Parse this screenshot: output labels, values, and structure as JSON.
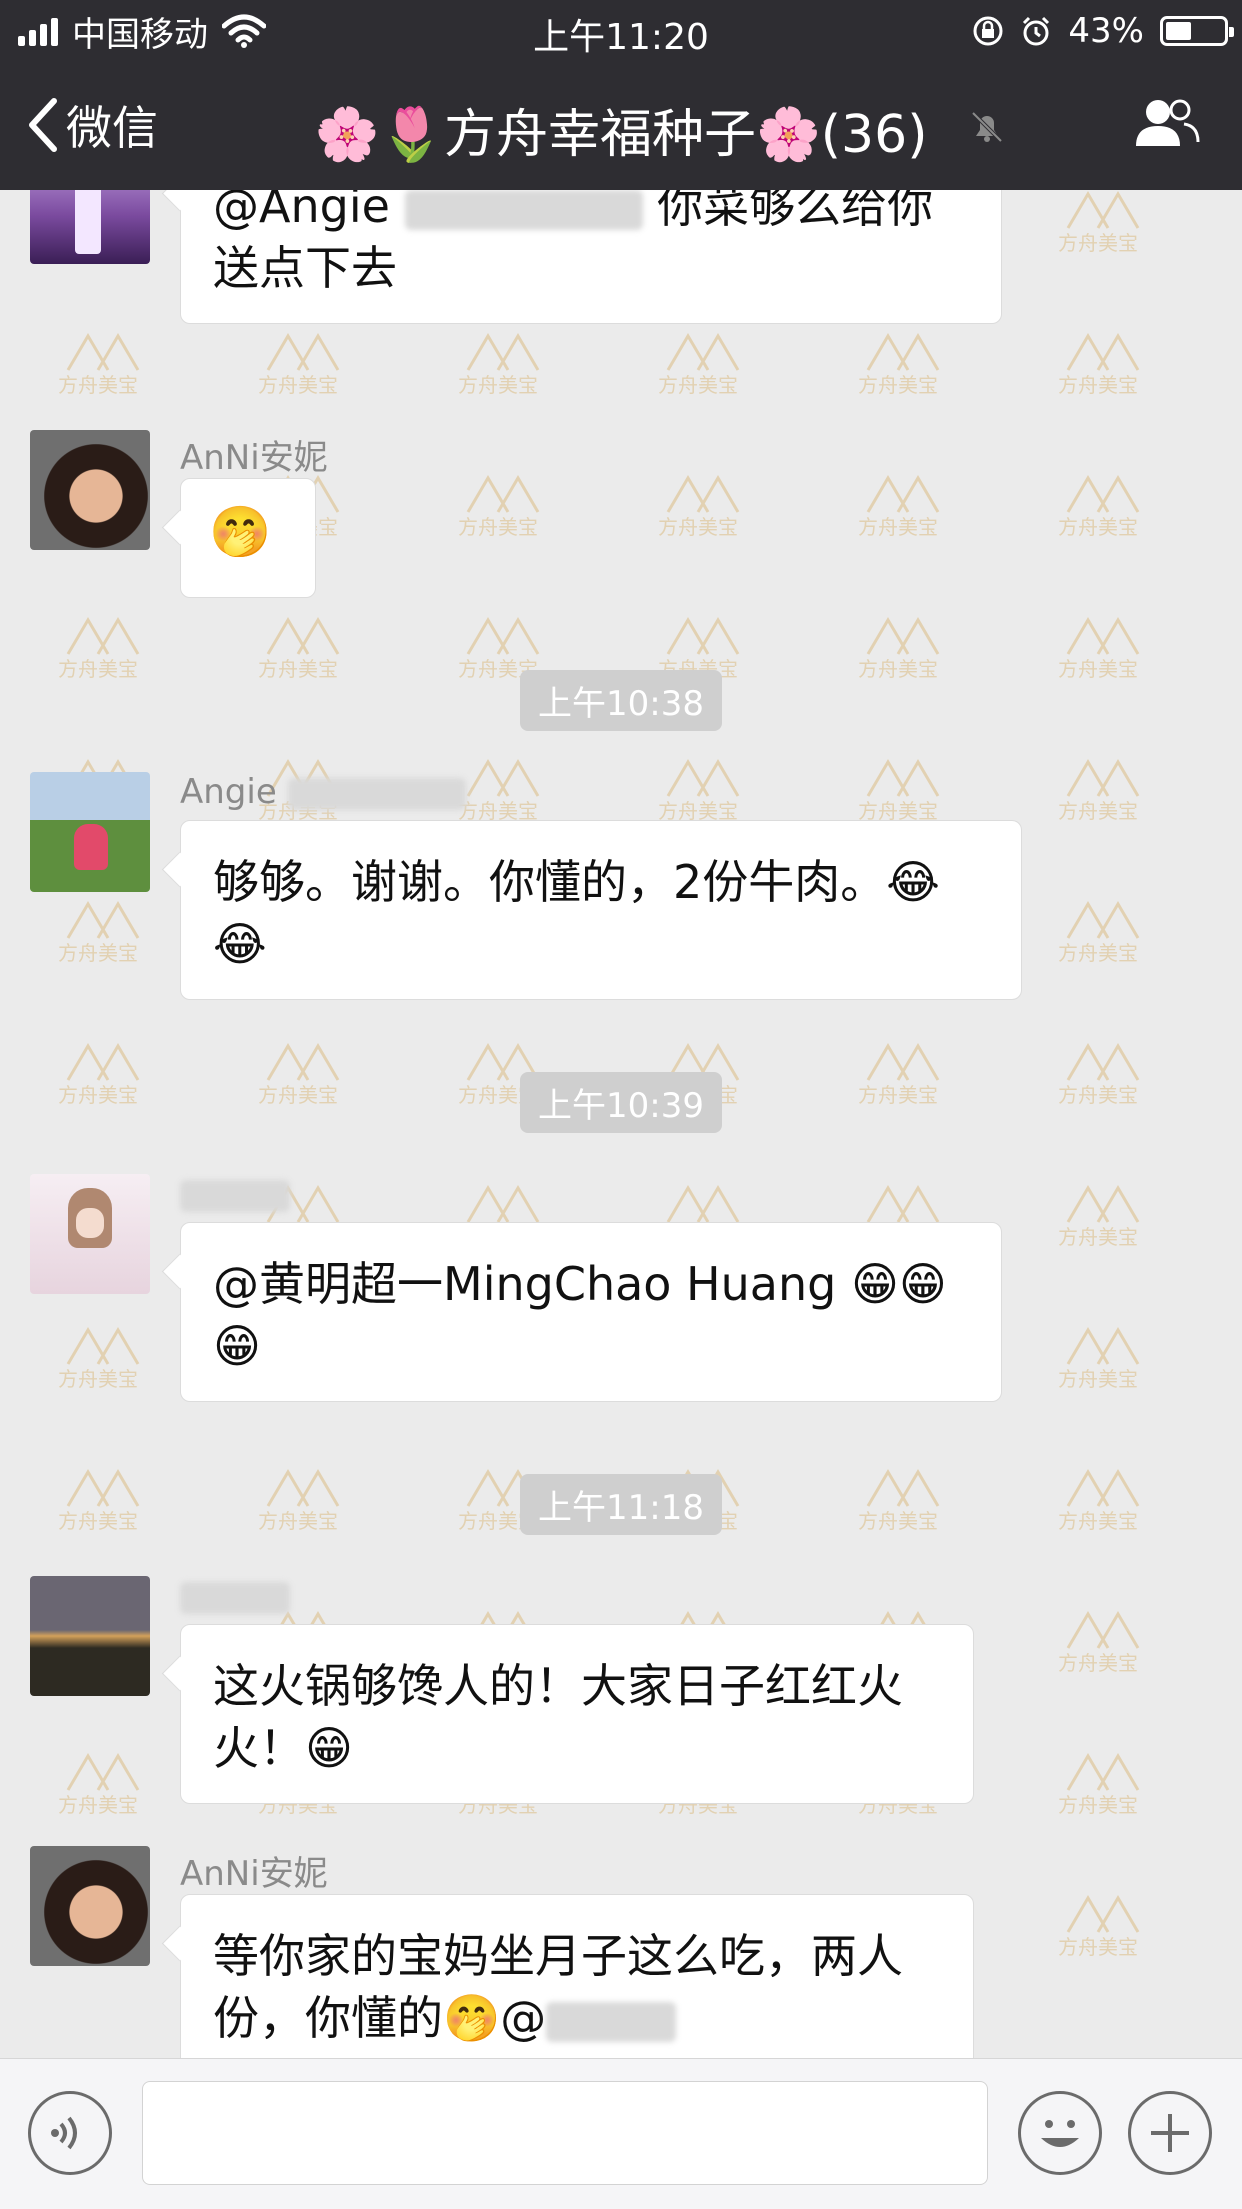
{
  "status_bar": {
    "carrier": "中国移动",
    "time": "上午11:20",
    "battery_percent": "43%",
    "battery_level": 0.43,
    "icons": [
      "signal-icon",
      "wifi-icon",
      "rotation-lock-icon",
      "alarm-icon",
      "battery-icon"
    ]
  },
  "nav": {
    "back_label": "微信",
    "title": "🌸🌷方舟幸福种子🌸(36)",
    "icons": [
      "back-chevron-icon",
      "mute-bell-icon",
      "group-members-icon"
    ]
  },
  "messages": [
    {
      "sender": "",
      "text": "@Angie ",
      "text_after_blur": "你菜够么给你送点下去"
    },
    {
      "sender": "AnNi安妮",
      "text": "🤭"
    },
    {
      "timestamp": "上午10:38"
    },
    {
      "sender": "Angie",
      "text": "够够。谢谢。你懂的，2份牛肉。😂😂"
    },
    {
      "timestamp": "上午10:39"
    },
    {
      "sender": "",
      "text": "@黄明超一MingChao  Huang 😁😁😁"
    },
    {
      "timestamp": "上午11:18"
    },
    {
      "sender": "",
      "text": "这火锅够馋人的！大家日子红红火火！😁"
    },
    {
      "sender": "AnNi安妮",
      "text": "等你家的宝妈坐月子这么吃，两人份，你懂的🤭@"
    }
  ],
  "watermark": "方舟美宝",
  "input": {
    "placeholder": ""
  },
  "colors": {
    "bar_bg": "#2e2d32",
    "chat_bg": "#ebebeb",
    "bubble_bg": "#ffffff"
  }
}
